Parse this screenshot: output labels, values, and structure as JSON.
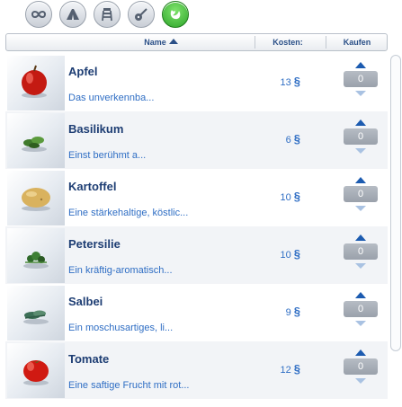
{
  "filters": [
    {
      "icon": "infinity-icon"
    },
    {
      "icon": "tent-icon"
    },
    {
      "icon": "lifeguard-chair-icon"
    },
    {
      "icon": "guitar-icon"
    },
    {
      "icon": "plant-leaf-icon",
      "active": true
    }
  ],
  "header": {
    "name_label": "Name",
    "cost_label": "Kosten:",
    "buy_label": "Kaufen"
  },
  "items": [
    {
      "name": "Apfel",
      "desc": "Das unverkennba...",
      "price": "13",
      "currency": "§",
      "qty": "0",
      "thumb": "apple"
    },
    {
      "name": "Basilikum",
      "desc": "Einst berühmt a...",
      "price": "6",
      "currency": "§",
      "qty": "0",
      "thumb": "basil"
    },
    {
      "name": "Kartoffel",
      "desc": "Eine stärkehaltige, köstlic...",
      "price": "10",
      "currency": "§",
      "qty": "0",
      "thumb": "potato"
    },
    {
      "name": "Petersilie",
      "desc": "Ein kräftig-aromatisch...",
      "price": "10",
      "currency": "§",
      "qty": "0",
      "thumb": "parsley"
    },
    {
      "name": "Salbei",
      "desc": "Ein moschusartiges, li...",
      "price": "9",
      "currency": "§",
      "qty": "0",
      "thumb": "sage"
    },
    {
      "name": "Tomate",
      "desc": "Eine saftige Frucht mit rot...",
      "price": "12",
      "currency": "§",
      "qty": "0",
      "thumb": "tomato"
    }
  ],
  "colors": {
    "accent_text": "#2f6ec4",
    "name_text": "#1d3d73",
    "quantity_box": "#a8aeb7",
    "active_filter": "#2ea52a"
  }
}
